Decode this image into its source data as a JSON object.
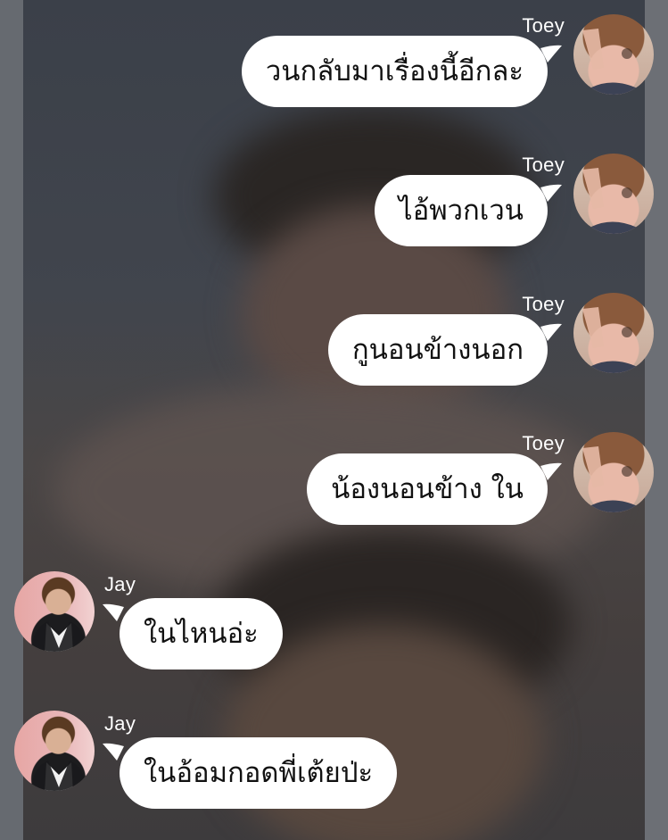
{
  "messages": [
    {
      "sender": "Toey",
      "text": "วนกลับมาเรื่องนี้อีกละ",
      "side": "right",
      "avatar_icon": "person-avatar-icon"
    },
    {
      "sender": "Toey",
      "text": "ไอ้พวกเวน",
      "side": "right",
      "avatar_icon": "person-avatar-icon"
    },
    {
      "sender": "Toey",
      "text": "กูนอนข้างนอก",
      "side": "right",
      "avatar_icon": "person-avatar-icon"
    },
    {
      "sender": "Toey",
      "text": "น้องนอนข้าง ใน",
      "side": "right",
      "avatar_icon": "person-avatar-icon"
    },
    {
      "sender": "Jay",
      "text": "ในไหนอ่ะ",
      "side": "left",
      "avatar_icon": "person-avatar-icon"
    },
    {
      "sender": "Jay",
      "text": "ในอ้อมกอดพี่เต้ยป่ะ",
      "side": "left",
      "avatar_icon": "person-avatar-icon"
    }
  ],
  "colors": {
    "bubble": "#ffffff",
    "text": "#111111",
    "name": "#ffffff",
    "background": "#3a3f48"
  }
}
